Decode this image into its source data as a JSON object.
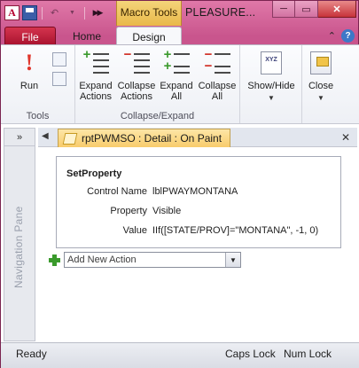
{
  "titlebar": {
    "app_icon_letter": "A",
    "contextual_tab": "Macro Tools",
    "document_title": "PLEASURE...",
    "minimize": "─",
    "restore": "▭",
    "close": "✕"
  },
  "tabs": {
    "file": "File",
    "home": "Home",
    "design": "Design",
    "active": "Design"
  },
  "ribbon": {
    "groups": {
      "tools": {
        "label": "Tools",
        "run_label": "Run"
      },
      "collapse_expand": {
        "label": "Collapse/Expand",
        "expand_actions": [
          "Expand",
          "Actions"
        ],
        "collapse_actions": [
          "Collapse",
          "Actions"
        ],
        "expand_all": [
          "Expand",
          "All"
        ],
        "collapse_all": [
          "Collapse",
          "All"
        ]
      },
      "show_hide": {
        "label": "Show/Hide",
        "icon_text": "XYZ"
      },
      "close": {
        "label": "Close"
      }
    }
  },
  "navigation_pane": {
    "label": "Navigation Pane",
    "toggle": "»"
  },
  "document": {
    "tab_title": "rptPWMSO : Detail : On Paint",
    "close": "✕",
    "macro": {
      "action": "SetProperty",
      "arguments": [
        {
          "name": "Control Name",
          "value": "lblPWAYMONTANA"
        },
        {
          "name": "Property",
          "value": "Visible"
        },
        {
          "name": "Value",
          "value": "IIf([STATE/PROV]=\"MONTANA\", -1, 0)"
        }
      ]
    },
    "add_action": {
      "placeholder": "Add New Action"
    }
  },
  "statusbar": {
    "status": "Ready",
    "caps_lock": "Caps Lock",
    "num_lock": "Num Lock"
  },
  "colors": {
    "window_accent": "#c9558d",
    "file_tab": "#b3193a",
    "contextual_tab": "#f1c95c",
    "document_tab": "#f9d27a"
  }
}
